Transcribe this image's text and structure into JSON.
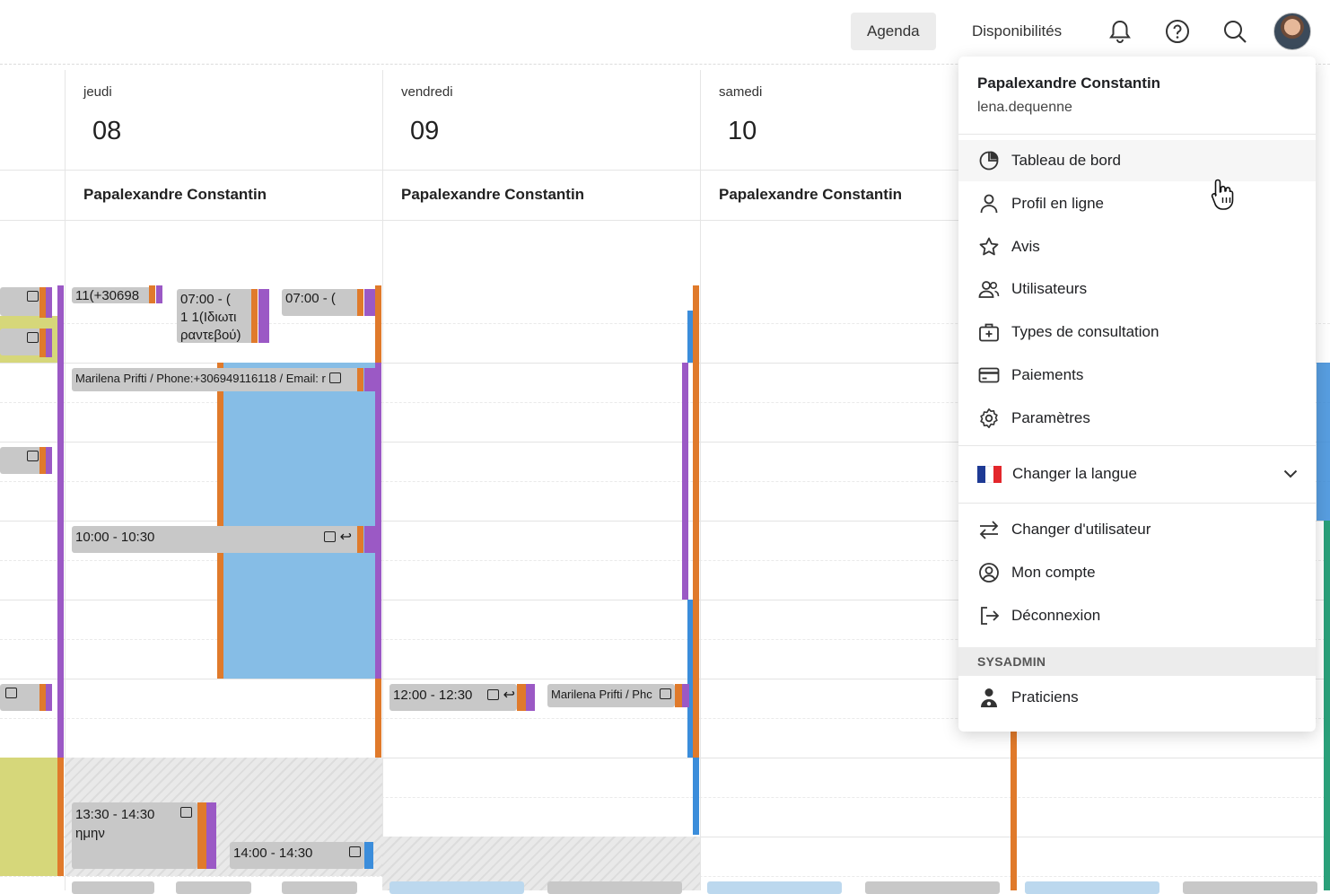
{
  "topbar": {
    "agenda_label": "Agenda",
    "availability_label": "Disponibilités",
    "icons": [
      "bell-icon",
      "help-icon",
      "search-icon",
      "avatar"
    ]
  },
  "days": [
    {
      "name": "jeudi",
      "number": "08",
      "practitioner": "Papalexandre Constantin"
    },
    {
      "name": "vendredi",
      "number": "09",
      "practitioner": "Papalexandre Constantin"
    },
    {
      "name": "samedi",
      "number": "10",
      "practitioner": "Papalexandre Constantin"
    }
  ],
  "events": {
    "e1": "11(+30698",
    "e2a": "07:00 - (",
    "e2b": "1 1(Ιδιωτι",
    "e2c": "ραντεβού)",
    "e3": "07:00 - (",
    "e4": "Marilena Prifti / Phone:+306949116118 / Email: r",
    "e5": "10:00 - 10:30",
    "e6": "12:00 - 12:30",
    "e7": "Marilena Prifti / Phc",
    "e8a": "13:30 - 14:30",
    "e8b": "ημην",
    "e9": "14:00 - 14:30"
  },
  "menu": {
    "user_name": "Papalexandre Constantin",
    "user_login": "lena.dequenne",
    "items": [
      {
        "label": "Tableau de bord",
        "icon": "pie-chart-icon"
      },
      {
        "label": "Profil en ligne",
        "icon": "profile-icon"
      },
      {
        "label": "Avis",
        "icon": "star-icon"
      },
      {
        "label": "Utilisateurs",
        "icon": "users-icon"
      },
      {
        "label": "Types de consultation",
        "icon": "medical-kit-icon"
      },
      {
        "label": "Paiements",
        "icon": "credit-card-icon"
      },
      {
        "label": "Paramètres",
        "icon": "gear-icon"
      }
    ],
    "language_label": "Changer la langue",
    "account_items": [
      {
        "label": "Changer d'utilisateur",
        "icon": "swap-icon"
      },
      {
        "label": "Mon compte",
        "icon": "account-circle-icon"
      },
      {
        "label": "Déconnexion",
        "icon": "logout-icon"
      }
    ],
    "sysadmin_label": "SYSADMIN",
    "sysadmin_items": [
      {
        "label": "Praticiens",
        "icon": "doctor-icon"
      }
    ]
  },
  "colors": {
    "event_gray": "#c8c8c8",
    "accent_orange": "#e07a2b",
    "accent_purple": "#9b59c5",
    "accent_blue": "#3b8ddb",
    "blocked_yellow": "#d6d77a",
    "busy_blue": "#86bde6"
  }
}
